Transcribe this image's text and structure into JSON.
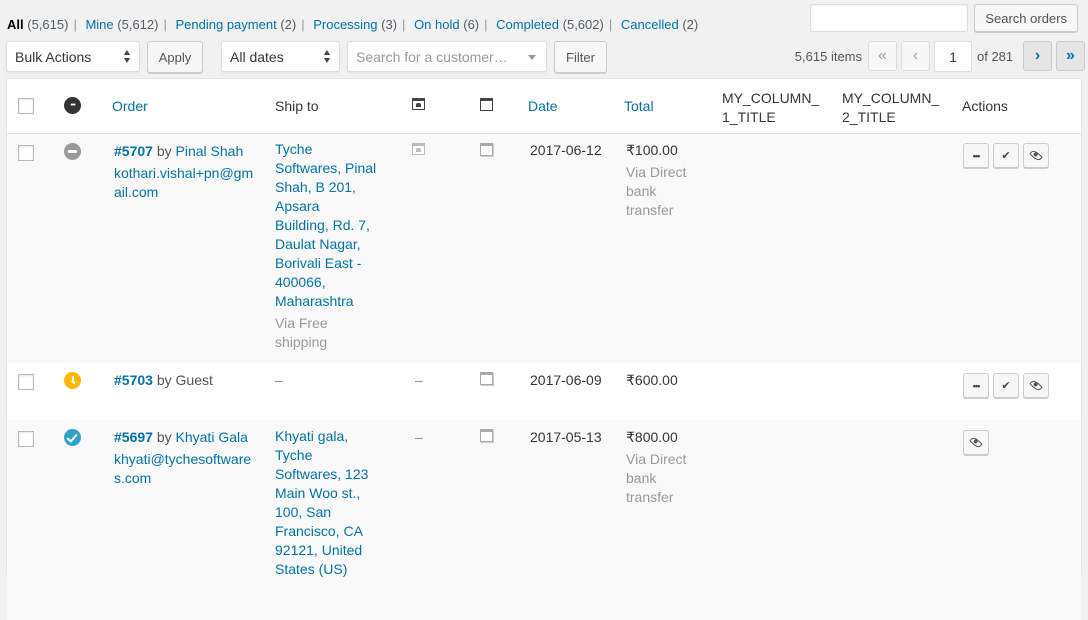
{
  "status_filters": [
    {
      "label": "All",
      "count": "(5,615)",
      "current": true
    },
    {
      "label": "Mine",
      "count": "(5,612)"
    },
    {
      "label": "Pending payment",
      "count": "(2)"
    },
    {
      "label": "Processing",
      "count": "(3)"
    },
    {
      "label": "On hold",
      "count": "(6)"
    },
    {
      "label": "Completed",
      "count": "(5,602)"
    },
    {
      "label": "Cancelled",
      "count": "(2)"
    }
  ],
  "search": {
    "input_value": "",
    "button_label": "Search orders"
  },
  "tablenav": {
    "bulk_actions": "Bulk Actions",
    "apply_label": "Apply",
    "date_filter": "All dates",
    "customer_placeholder": "Search for a customer…",
    "filter_label": "Filter",
    "items_count": "5,615 items",
    "first_page": "«",
    "prev_page": "‹",
    "current_page": "1",
    "total_pages": "of 281",
    "next_page": "›",
    "last_page": "»"
  },
  "columns": {
    "order": "Order",
    "ship_to": "Ship to",
    "date": "Date",
    "total": "Total",
    "my_column_1_line1": "MY_COLUMN_",
    "my_column_1_line2": "1_TITLE",
    "my_column_2_line1": "MY_COLUMN_",
    "my_column_2_line2": "2_TITLE",
    "actions": "Actions"
  },
  "orders": [
    {
      "status": "cancelled",
      "number": "#5707",
      "by": "by",
      "customer": "Pinal Shah",
      "email": "kothari.vishal+pn@gmail.com",
      "ship_to_lines": [
        "Tyche",
        "Softwares, Pinal",
        "Shah, B 201,",
        "Apsara",
        "Building, Rd. 7,",
        "Daulat Nagar,",
        "Borivali East -",
        "400066,",
        "Maharashtra"
      ],
      "shipping_method": [
        "Via Free",
        "shipping"
      ],
      "billing_icon": true,
      "date": "2017-06-12",
      "total": "₹100.00",
      "payment_method": [
        "Via Direct",
        "bank",
        "transfer"
      ],
      "actions": [
        "more",
        "complete",
        "view"
      ]
    },
    {
      "status": "pending",
      "number": "#5703",
      "by": "by",
      "customer": "Guest",
      "email": "",
      "ship_to_dash": "–",
      "billing_dash": "–",
      "date": "2017-06-09",
      "total": "₹600.00",
      "actions": [
        "more",
        "complete",
        "view"
      ]
    },
    {
      "status": "completed",
      "number": "#5697",
      "by": "by",
      "customer": "Khyati Gala",
      "email": "khyati@tychesoftwares.com",
      "ship_to_lines": [
        "Khyati gala,",
        "Tyche",
        "Softwares, 123",
        "Main Woo st.,",
        "100, San",
        "Francisco, CA",
        "92121, United",
        "States (US)"
      ],
      "billing_dash": "–",
      "date": "2017-05-13",
      "total": "₹800.00",
      "payment_method": [
        "Via Direct",
        "bank",
        "transfer"
      ],
      "actions": [
        "view"
      ]
    }
  ]
}
